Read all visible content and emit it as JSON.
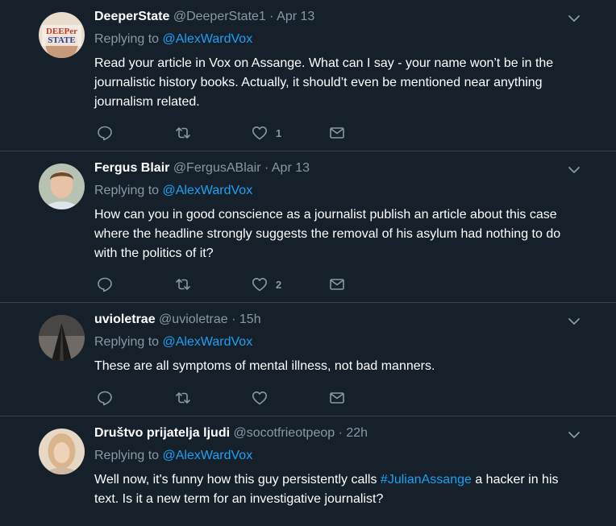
{
  "tweets": [
    {
      "name": "DeeperState",
      "handle": "@DeeperState1",
      "separator": "·",
      "time": "Apr 13",
      "replying_prefix": "Replying to ",
      "replying_to": "@AlexWardVox",
      "body": "Read your article in Vox on Assange. What can I say - your name won’t be in the journalistic history books. Actually, it should’t even be mentioned near anything journalism related.",
      "avatar_text": [
        "DEEPer",
        "STATE"
      ],
      "reply_count": "",
      "retweet_count": "",
      "like_count": "1"
    },
    {
      "name": "Fergus Blair",
      "handle": "@FergusABlair",
      "separator": "·",
      "time": "Apr 13",
      "replying_prefix": "Replying to ",
      "replying_to": "@AlexWardVox",
      "body": "How can you in good conscience as a journalist publish an article about this case where the headline strongly suggests the removal of his asylum had nothing to do with the politics of it?",
      "reply_count": "",
      "retweet_count": "",
      "like_count": "2"
    },
    {
      "name": "uvioletrae",
      "handle": "@uvioletrae",
      "separator": "·",
      "time": "15h",
      "replying_prefix": "Replying to ",
      "replying_to": "@AlexWardVox",
      "body": "These are all symptoms of mental illness, not bad manners.",
      "reply_count": "",
      "retweet_count": "",
      "like_count": ""
    },
    {
      "name": "Društvo prijatelja ljudi",
      "handle": "@socotfrieotpeop",
      "separator": "·",
      "time": "22h",
      "replying_prefix": "Replying to ",
      "replying_to": "@AlexWardVox",
      "body_before": "Well now, it's funny how this guy persistently calls ",
      "body_hashtag": "#JulianAssange",
      "body_after": " a hacker in his text. Is it a new term for an investigative journalist?",
      "reply_count": "",
      "retweet_count": "",
      "like_count": ""
    }
  ],
  "icons": {
    "reply": "reply-icon",
    "retweet": "retweet-icon",
    "like": "like-icon",
    "dm": "direct-message-icon",
    "more": "chevron-down-icon"
  },
  "colors": {
    "background": "#15202b",
    "divider": "#38444d",
    "muted": "#8899a6",
    "link": "#1da1f2"
  }
}
